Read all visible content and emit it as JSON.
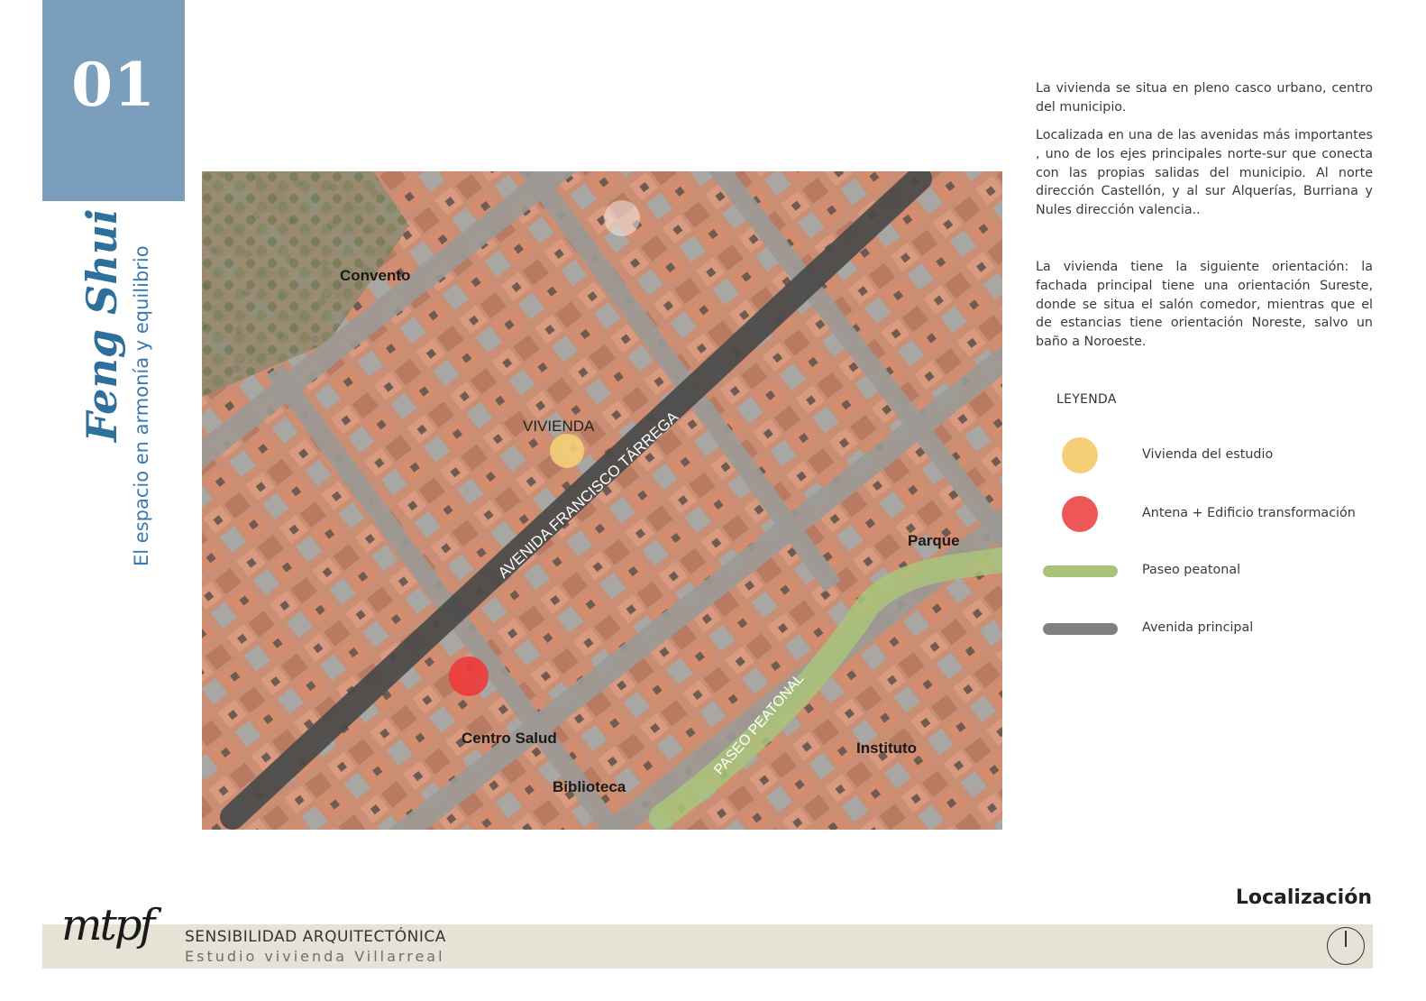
{
  "header": {
    "section_number": "01",
    "title": "Feng Shui",
    "subtitle": "El espacio en armonía y equilibrio"
  },
  "map": {
    "labels": {
      "convento": "Convento",
      "vivienda": "VIVIENDA",
      "avenida": "AVENIDA FRANCISCO TÁRREGA",
      "parque": "Parque",
      "paseo": "PASEO PEATONAL",
      "centro_salud": "Centro Salud",
      "biblioteca": "Biblioteca",
      "instituto": "Instituto"
    }
  },
  "description": {
    "p1": "La vivienda se situa en pleno casco urbano, centro del municipio.",
    "p2": "Localizada en una de las avenidas más importantes , uno de los ejes principales norte-sur que conecta con las propias salidas del municipio. Al norte dirección Castellón, y al sur Alquerías, Burriana y Nules dirección valencia..",
    "p3": "La vivienda tiene la siguiente orientación: la fachada principal tiene una orientación Sureste, donde se situa el salón comedor, mientras que el de estancias tiene orientación Noreste, salvo un baño a Noroeste."
  },
  "legend": {
    "title": "LEYENDA",
    "items": [
      {
        "label": "Vivienda del estudio",
        "color": "#f4cf78",
        "kind": "dot"
      },
      {
        "label": "Antena + Edificio transformación",
        "color": "#ee5757",
        "kind": "dot"
      },
      {
        "label": "Paseo peatonal",
        "color": "#a9c47a",
        "kind": "bar"
      },
      {
        "label": "Avenida principal",
        "color": "#808080",
        "kind": "bar"
      }
    ]
  },
  "footer": {
    "section_label": "Localización",
    "logo": "mtpf",
    "title": "SENSIBILIDAD ARQUITECTÓNICA",
    "subtitle": "Estudio vivienda Villarreal"
  },
  "colors": {
    "accent": "#7a9ebb",
    "title_blue": "#2f6f9c",
    "footer_band": "#e5e2d6"
  }
}
